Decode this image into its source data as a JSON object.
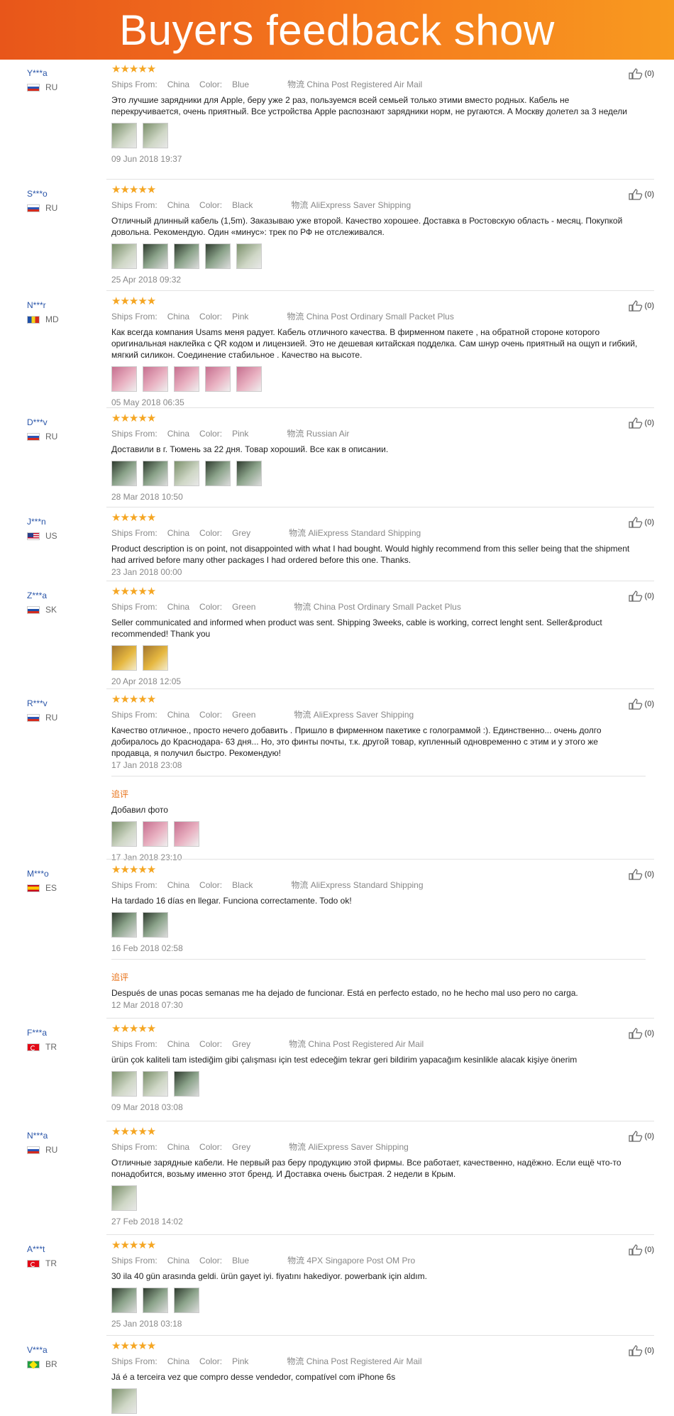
{
  "banner": {
    "title": "Buyers feedback show"
  },
  "labels": {
    "ships_from": "Ships From:",
    "color": "Color:",
    "followup": "追评"
  },
  "reviews": [
    {
      "user": "Y***a",
      "country": "RU",
      "stars": "★★★★★",
      "ships_from": "China",
      "color": "Blue",
      "shipping": "物流 China Post Registered Air Mail",
      "text": "Это лучшие зарядники для Apple, беру уже 2 раз, пользуемся всей семьей только этими вместо родных. Кабель не перекручивается, очень приятный. Все устройства Apple распознают зарядники норм, не ругаются. А Москву долетел за 3 недели",
      "date": "09 Jun 2018 19:37",
      "likes": "(0)"
    },
    {
      "user": "S***o",
      "country": "RU",
      "stars": "★★★★★",
      "ships_from": "China",
      "color": "Black",
      "shipping": "物流 AliExpress Saver Shipping",
      "text": "Отличный длинный кабель (1,5m). Заказываю уже второй. Качество хорошее. Доставка в Ростовскую область - месяц. Покупкой довольна. Рекомендую. Один «минус»: трек по РФ не отслеживался.",
      "date": "25 Apr 2018 09:32",
      "likes": "(0)"
    },
    {
      "user": "N***r",
      "country": "MD",
      "stars": "★★★★★",
      "ships_from": "China",
      "color": "Pink",
      "shipping": "物流 China Post Ordinary Small Packet Plus",
      "text": "Как всегда компания Usams меня радует. Кабель отличного качества. В фирменном пакете , на обратной стороне которого оригинальная наклейка с QR кодом и лицензией. Это не дешевая китайская подделка. Сам шнур очень приятный на ощуп и гибкий, мягкий силикон. Соединение стабильное . Качество на высоте.",
      "date": "05 May 2018 06:35",
      "likes": "(0)"
    },
    {
      "user": "D***v",
      "country": "RU",
      "stars": "★★★★★",
      "ships_from": "China",
      "color": "Pink",
      "shipping": "物流 Russian Air",
      "text": "Доставили в г. Тюмень за 22 дня. Товар хороший. Все как в описании.",
      "date": "28 Mar 2018 10:50",
      "likes": "(0)"
    },
    {
      "user": "J***n",
      "country": "US",
      "stars": "★★★★★",
      "ships_from": "China",
      "color": "Grey",
      "shipping": "物流 AliExpress Standard Shipping",
      "text": "Product description is on point, not disappointed with what I had bought. Would highly recommend from this seller being that the shipment had arrived before many other packages I had ordered before this one. Thanks.",
      "date": "23 Jan 2018 00:00",
      "likes": "(0)"
    },
    {
      "user": "Z***a",
      "country": "SK",
      "stars": "★★★★★",
      "ships_from": "China",
      "color": "Green",
      "shipping": "物流 China Post Ordinary Small Packet Plus",
      "text": "Seller communicated and informed when product was sent. Shipping 3weeks, cable is working, correct lenght sent. Seller&product recommended! Thank you",
      "date": "20 Apr 2018 12:05",
      "likes": "(0)"
    },
    {
      "user": "R***v",
      "country": "RU",
      "stars": "★★★★★",
      "ships_from": "China",
      "color": "Green",
      "shipping": "物流 AliExpress Saver Shipping",
      "text": "Качество отличное., просто нечего добавить . Пришло в фирменном пакетике с голограммой :). Единственно... очень долго добиралось до Краснодара- 63 дня... Но, это финты почты, т.к. другой товар, купленный одновременно с этим и у этого же продавца, я получил быстро. Рекомендую!",
      "date": "17 Jan 2018 23:08",
      "followup_text": "Добавил фото",
      "followup_date": "17 Jan 2018 23:10",
      "likes": "(0)"
    },
    {
      "user": "M***o",
      "country": "ES",
      "stars": "★★★★★",
      "ships_from": "China",
      "color": "Black",
      "shipping": "物流 AliExpress Standard Shipping",
      "text": "Ha tardado 16 días en llegar. Funciona correctamente. Todo ok!",
      "date": "16 Feb 2018 02:58",
      "followup_text": "Después de unas pocas semanas me ha dejado de funcionar. Está en perfecto estado, no he hecho mal uso pero no carga.",
      "followup_date": "12 Mar 2018 07:30",
      "likes": "(0)"
    },
    {
      "user": "F***a",
      "country": "TR",
      "stars": "★★★★★",
      "ships_from": "China",
      "color": "Grey",
      "shipping": "物流 China Post Registered Air Mail",
      "text": "ürün çok kaliteli tam istediğim gibi çalışması için test edeceğim tekrar geri bildirim yapacağım kesinlikle alacak kişiye önerim",
      "date": "09 Mar 2018 03:08",
      "likes": "(0)"
    },
    {
      "user": "N***a",
      "country": "RU",
      "stars": "★★★★★",
      "ships_from": "China",
      "color": "Grey",
      "shipping": "物流 AliExpress Saver Shipping",
      "text": "Отличные зарядные кабели. Не первый раз беру продукцию этой фирмы. Все работает, качественно, надёжно. Если ещё что-то понадобится, возьму именно этот бренд. И Доставка очень быстрая. 2 недели в Крым.",
      "date": "27 Feb 2018 14:02",
      "likes": "(0)"
    },
    {
      "user": "A***t",
      "country": "TR",
      "stars": "★★★★★",
      "ships_from": "China",
      "color": "Blue",
      "shipping": "物流 4PX Singapore Post OM Pro",
      "text": "30 ila 40 gün arasında geldi. ürün gayet iyi. fiyatını hakediyor. powerbank için aldım.",
      "date": "25 Jan 2018 03:18",
      "likes": "(0)"
    },
    {
      "user": "V***a",
      "country": "BR",
      "stars": "★★★★★",
      "ships_from": "China",
      "color": "Pink",
      "shipping": "物流 China Post Registered Air Mail",
      "text": "Já é a terceira vez que compro desse vendedor, compatível com iPhone 6s",
      "date": "",
      "likes": "(0)"
    }
  ]
}
